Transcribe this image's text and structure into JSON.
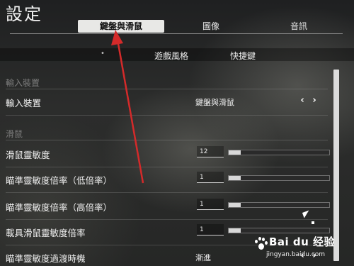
{
  "title": "設定",
  "main_tabs": [
    {
      "label": "鍵盤與滑鼠",
      "active": true
    },
    {
      "label": "圖像",
      "active": false
    },
    {
      "label": "音訊",
      "active": false
    }
  ],
  "sub_tabs": [
    "遊戲風格",
    "快捷鍵"
  ],
  "sections": {
    "input": {
      "header": "輸入裝置",
      "row": {
        "label": "輸入裝置",
        "value": "鍵盤與滑鼠"
      }
    },
    "mouse": {
      "header": "滑鼠",
      "rows": [
        {
          "label": "滑鼠靈敏度",
          "value": "12",
          "level": 0.12
        },
        {
          "label": "瞄準靈敏度倍率（低倍率）",
          "value": "1",
          "level": 0.12
        },
        {
          "label": "瞄準靈敏度倍率（高倍率）",
          "value": "1",
          "level": 0.12
        },
        {
          "label": "載具滑鼠靈敏度倍率",
          "value": "1",
          "level": 0.12
        }
      ],
      "transition_row": {
        "label": "瞄準靈敏度過渡時機",
        "value": "漸進"
      }
    }
  },
  "arrows": {
    "prev": "‹",
    "next": "›"
  },
  "watermark": {
    "logo": "Bai du 经验",
    "sub": "jingyan.baidu.com"
  },
  "colors": {
    "annotation_arrow": "#d42a2a",
    "active_tab_bg": "#e8e8e6"
  }
}
